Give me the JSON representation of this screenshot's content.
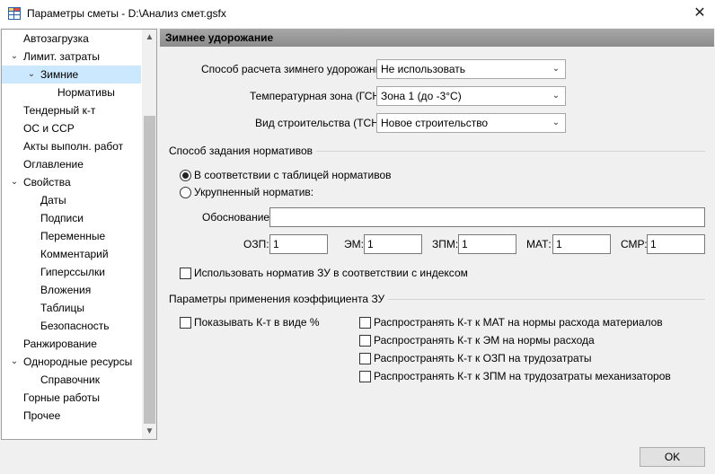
{
  "window": {
    "title": "Параметры сметы - D:\\Анализ смет.gsfx",
    "close_glyph": "✕"
  },
  "sidebar": {
    "items": [
      {
        "label": "Автозагрузка",
        "level": 0,
        "chevron": "",
        "selected": false
      },
      {
        "label": "Лимит. затраты",
        "level": 0,
        "chevron": "⌄",
        "selected": false
      },
      {
        "label": "Зимние",
        "level": 1,
        "chevron": "⌄",
        "selected": true
      },
      {
        "label": "Нормативы",
        "level": 2,
        "chevron": "",
        "selected": false
      },
      {
        "label": "Тендерный к-т",
        "level": 0,
        "chevron": "",
        "selected": false
      },
      {
        "label": "ОС и ССР",
        "level": 0,
        "chevron": "",
        "selected": false
      },
      {
        "label": "Акты выполн. работ",
        "level": 0,
        "chevron": "",
        "selected": false
      },
      {
        "label": "Оглавление",
        "level": 0,
        "chevron": "",
        "selected": false
      },
      {
        "label": "Свойства",
        "level": 0,
        "chevron": "⌄",
        "selected": false
      },
      {
        "label": "Даты",
        "level": 1,
        "chevron": "",
        "selected": false
      },
      {
        "label": "Подписи",
        "level": 1,
        "chevron": "",
        "selected": false
      },
      {
        "label": "Переменные",
        "level": 1,
        "chevron": "",
        "selected": false
      },
      {
        "label": "Комментарий",
        "level": 1,
        "chevron": "",
        "selected": false
      },
      {
        "label": "Гиперссылки",
        "level": 1,
        "chevron": "",
        "selected": false
      },
      {
        "label": "Вложения",
        "level": 1,
        "chevron": "",
        "selected": false
      },
      {
        "label": "Таблицы",
        "level": 1,
        "chevron": "",
        "selected": false
      },
      {
        "label": "Безопасность",
        "level": 1,
        "chevron": "",
        "selected": false
      },
      {
        "label": "Ранжирование",
        "level": 0,
        "chevron": "",
        "selected": false
      },
      {
        "label": "Однородные ресурсы",
        "level": 0,
        "chevron": "⌄",
        "selected": false
      },
      {
        "label": "Справочник",
        "level": 1,
        "chevron": "",
        "selected": false
      },
      {
        "label": "Горные работы",
        "level": 0,
        "chevron": "",
        "selected": false
      },
      {
        "label": "Прочее",
        "level": 0,
        "chevron": "",
        "selected": false
      }
    ],
    "scroll_up_glyph": "▲",
    "scroll_down_glyph": "▼"
  },
  "main": {
    "header": "Зимнее удорожание",
    "fields": {
      "method_label": "Способ расчета зимнего удорожания:",
      "method_value": "Не использовать",
      "zone_label": "Температурная зона (ГСН):",
      "zone_value": "Зона 1 (до -3°С)",
      "construction_label": "Вид строительства (ТСН):",
      "construction_value": "Новое строительство"
    },
    "norm_group": {
      "title": "Способ задания нормативов",
      "radio_table": "В соответствии с таблицей нормативов",
      "radio_table_checked": true,
      "radio_aggregated": "Укрупненный норматив:",
      "radio_aggregated_checked": false,
      "basis_label": "Обоснование:",
      "basis_value": "",
      "coefs": [
        {
          "label": "ОЗП:",
          "value": "1"
        },
        {
          "label": "ЭМ:",
          "value": "1"
        },
        {
          "label": "ЗПМ:",
          "value": "1"
        },
        {
          "label": "МАТ:",
          "value": "1"
        },
        {
          "label": "СМР:",
          "value": "1"
        }
      ],
      "use_index_label": "Использовать норматив ЗУ в соответствии с индексом",
      "use_index_checked": false
    },
    "apply_group": {
      "title": "Параметры применения коэффициента ЗУ",
      "show_percent_label": "Показывать К-т в виде %",
      "show_percent_checked": false,
      "spread": [
        {
          "label": "Распространять К-т к МАТ на нормы расхода материалов",
          "checked": false
        },
        {
          "label": "Распространять К-т к ЭМ на нормы расхода",
          "checked": false
        },
        {
          "label": "Распространять К-т к ОЗП на трудозатраты",
          "checked": false
        },
        {
          "label": "Распространять К-т к ЗПМ на трудозатраты механизаторов",
          "checked": false
        }
      ]
    }
  },
  "footer": {
    "ok_label": "OK"
  },
  "colors": {
    "selected_bg": "#cce8ff",
    "header_bg": "#999999"
  }
}
